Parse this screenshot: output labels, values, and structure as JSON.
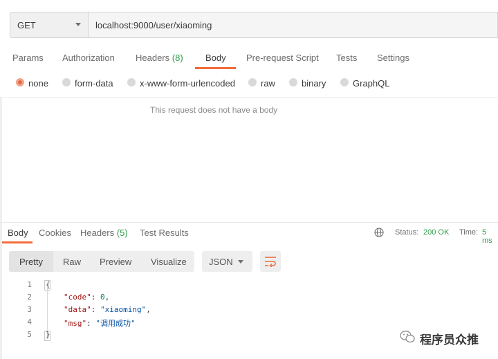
{
  "request": {
    "method": "GET",
    "url": "localhost:9000/user/xiaoming"
  },
  "request_tabs": [
    {
      "label": "Params"
    },
    {
      "label": "Authorization"
    },
    {
      "label": "Headers",
      "count": "(8)"
    },
    {
      "label": "Body"
    },
    {
      "label": "Pre-request Script"
    },
    {
      "label": "Tests"
    },
    {
      "label": "Settings"
    }
  ],
  "body_types": [
    {
      "label": "none",
      "selected": true
    },
    {
      "label": "form-data"
    },
    {
      "label": "x-www-form-urlencoded"
    },
    {
      "label": "raw"
    },
    {
      "label": "binary"
    },
    {
      "label": "GraphQL"
    }
  ],
  "empty_body_message": "This request does not have a body",
  "response_tabs": [
    {
      "label": "Body"
    },
    {
      "label": "Cookies"
    },
    {
      "label": "Headers",
      "count": "(5)"
    },
    {
      "label": "Test Results"
    }
  ],
  "status": {
    "status_label": "Status:",
    "status_value": "200 OK",
    "time_label": "Time:",
    "time_value": "5 ms"
  },
  "view_modes": [
    "Pretty",
    "Raw",
    "Preview",
    "Visualize"
  ],
  "format": "JSON",
  "code": {
    "line_numbers": [
      "1",
      "2",
      "3",
      "4",
      "5"
    ],
    "open_brace": "{",
    "close_brace": "}",
    "fields": [
      {
        "key": "\"code\"",
        "sep": ": ",
        "value": "0",
        "trail": ","
      },
      {
        "key": "\"data\"",
        "sep": ": ",
        "value": "\"xiaoming\"",
        "trail": ","
      },
      {
        "key": "\"msg\"",
        "sep": ": ",
        "value": "\"调用成功\"",
        "trail": ""
      }
    ]
  },
  "watermark": "程序员众推",
  "icons": {
    "method_dropdown": "chevron-down-icon",
    "format_dropdown": "chevron-down-icon",
    "wrap": "wrap-lines-icon",
    "globe": "globe-icon",
    "watermark": "wechat-icon"
  },
  "colors": {
    "accent": "#f26b3a",
    "count_green": "#2d9c48",
    "status_green": "#2d9c48",
    "json_key": "#a31515",
    "json_string": "#0451a5",
    "json_number": "#098658"
  }
}
